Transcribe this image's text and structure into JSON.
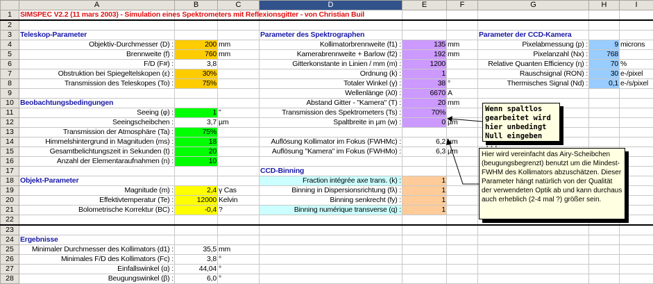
{
  "columns": [
    "A",
    "B",
    "C",
    "D",
    "E",
    "F",
    "G",
    "H",
    "I"
  ],
  "selected_column": "D",
  "colors": {
    "orange": "#ffcc00",
    "green": "#00ff00",
    "yellow": "#ffff00",
    "purple": "#cc99ff",
    "blue": "#99ccff",
    "cyan": "#ccffff",
    "peach": "#ffcc99"
  },
  "rows": [
    {
      "n": "1",
      "cells": {
        "A": "SIMSPEC V2.2 (11 mars 2003) - Simulation eines Spektrometers mit Reflexionsgitter - von Christian Buil"
      }
    },
    {
      "n": "2",
      "cells": {}
    },
    {
      "n": "3",
      "cells": {
        "A": "Teleskop-Parameter",
        "D": "Parameter des Spektrographen",
        "G": "Parameter der CCD-Kamera"
      }
    },
    {
      "n": "4",
      "cells": {
        "A": "Objektiv-Durchmesser (D) :",
        "B": "200",
        "C": "mm",
        "D": "Kollimatorbrennweite (f1) :",
        "E": "135",
        "F": "mm",
        "G": "Pixelabmessung (p) :",
        "H": "9",
        "I": "microns"
      }
    },
    {
      "n": "5",
      "cells": {
        "A": "Brennweite (f) :",
        "B": "760",
        "C": "mm",
        "D": "Kamerabrennweite + Barlow (f2) :",
        "E": "192",
        "F": "mm",
        "G": "Pixelanzahl (Nx) :",
        "H": "768"
      }
    },
    {
      "n": "6",
      "cells": {
        "A": "F/D (F#) :",
        "B": "3,8",
        "D": "Gitterkonstante in Linien / mm (m) :",
        "E": "1200",
        "G": "Relative Quanten Efficiency (η) :",
        "H": "70",
        "I": "%"
      }
    },
    {
      "n": "7",
      "cells": {
        "A": "Obstruktion bei Spiegeltelskopen (ε) :",
        "B": "30%",
        "D": "Ordnung (k) :",
        "E": "1",
        "G": "Rauschsignal (RON) :",
        "H": "30",
        "I": "e-/pixel"
      }
    },
    {
      "n": "8",
      "cells": {
        "A": "Transmission des Teleskopes (To) :",
        "B": "75%",
        "D": "Totaler Winkel (γ) :",
        "E": "38",
        "F": "°",
        "G": "Thermisches Signal (Nd) :",
        "H": "0,1",
        "I": "e-/s/pixel"
      }
    },
    {
      "n": "9",
      "cells": {
        "D": "Wellenlänge (λ0) :",
        "E": "6670",
        "F": "A"
      }
    },
    {
      "n": "10",
      "cells": {
        "A": "Beobachtungsbedingungen",
        "D": "Abstand Gitter - \"Kamera\" (T) :",
        "E": "20",
        "F": "mm"
      }
    },
    {
      "n": "11",
      "cells": {
        "A": "Seeing (φ) :",
        "B": "1",
        "C": "\"",
        "D": "Transmission des Spektrometers (Ts) :",
        "E": "70%"
      }
    },
    {
      "n": "12",
      "cells": {
        "A": "Seeingscheibchen :",
        "B": "3,7",
        "C": "µm",
        "D": "Spaltbreite in µm (w) :",
        "E": "0",
        "F": "µm"
      }
    },
    {
      "n": "13",
      "cells": {
        "A": "Transmission der Atmosphäre (Ta) :",
        "B": "75%"
      }
    },
    {
      "n": "14",
      "cells": {
        "A": "Himmelshintergrund in Magnituden (ms) :",
        "B": "18",
        "D": "Auflösung Kollimator im Fokus (FWHMc) :",
        "E": "6,2",
        "F": "µm"
      }
    },
    {
      "n": "15",
      "cells": {
        "A": "Gesamtbelichtungszeit in Sekunden (t) :",
        "B": "20",
        "D": "Auflösung \"Kamera\" im Fokus (FWHMo) :",
        "E": "6,3",
        "F": "µm"
      }
    },
    {
      "n": "16",
      "cells": {
        "A": "Anzahl der Elementaraufnahmen (n) :",
        "B": "10"
      }
    },
    {
      "n": "17",
      "cells": {
        "D": "CCD-Binning"
      }
    },
    {
      "n": "18",
      "cells": {
        "A": "Objekt-Parameter",
        "D": "Fraction intégrée axe trans. (k) :",
        "E": "1"
      }
    },
    {
      "n": "19",
      "cells": {
        "A": "Magnitude (m) :",
        "B": "2,4",
        "C": "γ  Cas",
        "D": "Binning in Dispersionsrichtung (fλ) :",
        "E": "1"
      }
    },
    {
      "n": "20",
      "cells": {
        "A": "Effektivtemperatur  (Te) :",
        "B": "12000",
        "C": "Kelvin",
        "D": "Binning senkrecht (fy) :",
        "E": "1"
      }
    },
    {
      "n": "21",
      "cells": {
        "A": "Bolometrische Korrektur (BC) :",
        "B": "-0,4",
        "C": "?",
        "D": "Binning numérique transverse (q) :",
        "E": "1"
      }
    },
    {
      "n": "22",
      "cells": {}
    },
    {
      "n": "23",
      "cells": {}
    },
    {
      "n": "24",
      "cells": {
        "A": "Ergebnisse"
      }
    },
    {
      "n": "25",
      "cells": {
        "A": "Minimaler Durchmesser des Kollimators (d1) :",
        "B": "35,5",
        "C": "mm"
      }
    },
    {
      "n": "26",
      "cells": {
        "A": "Minimales F/D des Kollimators (Fc) :",
        "B": "3,8",
        "C": "°"
      }
    },
    {
      "n": "27",
      "cells": {
        "A": "Einfallswinkel (α) :",
        "B": "44,04",
        "C": "°"
      }
    },
    {
      "n": "28",
      "cells": {
        "A": "Beugungswinkel (β) :",
        "B": "6,0",
        "C": "°"
      }
    }
  ],
  "comments": [
    {
      "text": "Wenn spaltlos gearbeitet wird hier unbedingt Null eingeben !!!"
    },
    {
      "text": "Hier wird vereinfacht das Airy-Scheibchen (beugungsbegrenzt) benutzt um die Mindest-FWHM des Kollimators abzuschätzen. Dieser Parameter hängt natürlich von der Qualität der verwendeten Optik ab und kann durchaus auch erheblich (2-4 mal ?) größer sein."
    }
  ]
}
